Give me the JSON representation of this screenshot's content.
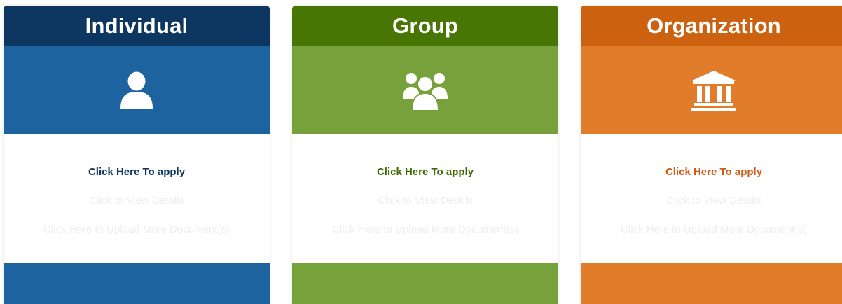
{
  "cards": [
    {
      "id": "individual",
      "title": "Individual",
      "icon": "user-icon",
      "apply_label": "Click Here To apply",
      "details_label": "Click to View Details",
      "upload_label": "Click Here to Upload More Document(s)",
      "colors": {
        "header": "#0d3760",
        "main": "#1d63a0",
        "apply_text": "#0d3760"
      }
    },
    {
      "id": "group",
      "title": "Group",
      "icon": "users-group-icon",
      "apply_label": "Click Here To apply",
      "details_label": "Click to View Details",
      "upload_label": "Click Here to Upload More Document(s)",
      "colors": {
        "header": "#487605",
        "main": "#77a13b",
        "apply_text": "#3f6b05"
      }
    },
    {
      "id": "organization",
      "title": "Organization",
      "icon": "bank-building-icon",
      "apply_label": "Click Here To apply",
      "details_label": "Click to View Details",
      "upload_label": "Click Here to Upload More Document(s)",
      "colors": {
        "header": "#cc620f",
        "main": "#e07c2a",
        "apply_text": "#cc5a12"
      }
    }
  ]
}
